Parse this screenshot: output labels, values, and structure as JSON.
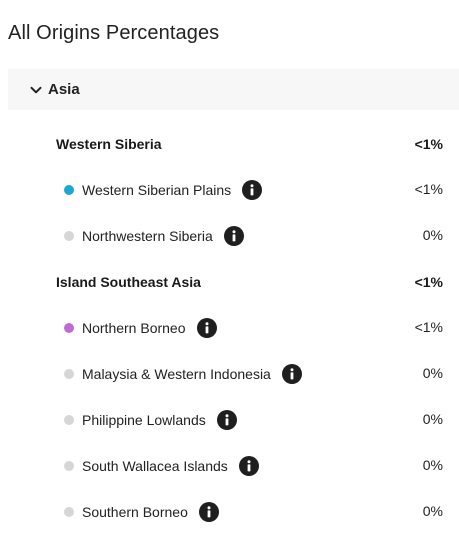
{
  "page_title": "All Origins Percentages",
  "section": {
    "label": "Asia",
    "expanded": true
  },
  "colors": {
    "western_siberian_plains": "#1aa7d6",
    "northern_borneo": "#c06ad6",
    "inactive": "#d6d6d6"
  },
  "groups": [
    {
      "name": "Western Siberia",
      "value": "<1%",
      "regions": [
        {
          "name": "Western Siberian Plains",
          "value": "<1%",
          "color": "#1aa7d6"
        },
        {
          "name": "Northwestern Siberia",
          "value": "0%",
          "color": "#d6d6d6"
        }
      ]
    },
    {
      "name": "Island Southeast Asia",
      "value": "<1%",
      "regions": [
        {
          "name": "Northern Borneo",
          "value": "<1%",
          "color": "#c06ad6"
        },
        {
          "name": "Malaysia & Western Indonesia",
          "value": "0%",
          "color": "#d6d6d6"
        },
        {
          "name": "Philippine Lowlands",
          "value": "0%",
          "color": "#d6d6d6"
        },
        {
          "name": "South Wallacea Islands",
          "value": "0%",
          "color": "#d6d6d6"
        },
        {
          "name": "Southern Borneo",
          "value": "0%",
          "color": "#d6d6d6"
        }
      ]
    }
  ]
}
